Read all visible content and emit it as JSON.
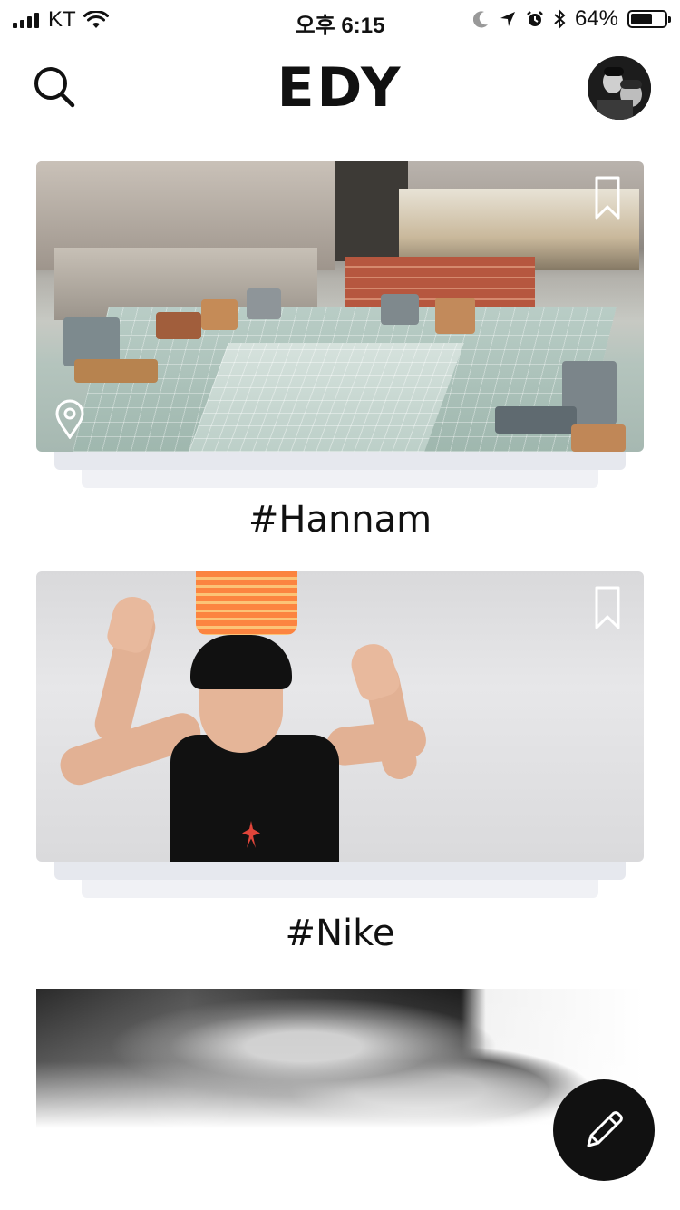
{
  "status_bar": {
    "carrier": "KT",
    "time": "오후 6:15",
    "battery_percent": "64%",
    "battery_level": 0.64,
    "signal_bars": 4
  },
  "header": {
    "logo": "EDY",
    "search_icon": "search-icon",
    "avatar_icon": "profile-avatar"
  },
  "feed": [
    {
      "tag": "#Hannam",
      "has_location": true,
      "bookmark_icon": "bookmark-icon"
    },
    {
      "tag": "#Nike",
      "has_location": false,
      "bookmark_icon": "bookmark-icon"
    },
    {
      "tag": "",
      "has_location": false
    }
  ],
  "fab": {
    "icon": "pencil-icon"
  },
  "colors": {
    "text": "#111111",
    "background": "#ffffff",
    "card_stack": "#e6e8ee",
    "fab": "#111111"
  }
}
